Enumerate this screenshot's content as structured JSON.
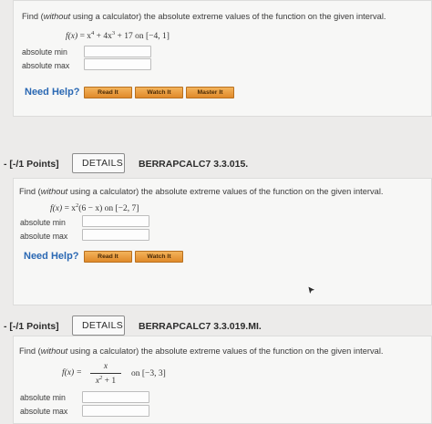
{
  "problem1": {
    "prompt_pre": "Find (",
    "prompt_em": "without",
    "prompt_post": " using a calculator) the absolute extreme values of the function on the given interval.",
    "f_label": "f(x)",
    "f_expr_a": " = x",
    "f_exp1": "4",
    "f_expr_b": " + 4x",
    "f_exp2": "3",
    "f_expr_c": " + 17 on [−4, 1]",
    "min_label": "absolute min",
    "max_label": "absolute max",
    "min_value": "",
    "max_value": "",
    "need_help": "Need Help?",
    "read_it": "Read It",
    "watch_it": "Watch It",
    "master_it": "Master It"
  },
  "problem2": {
    "points": "- [-/1 Points]",
    "details": "DETAILS",
    "code": "BERRAPCALC7 3.3.015.",
    "prompt_pre": "Find (",
    "prompt_em": "without",
    "prompt_post": " using a calculator) the absolute extreme values of the function on the given interval.",
    "f_label": "f(x)",
    "f_expr_a": " = x",
    "f_exp1": "2",
    "f_expr_b": "(6 − x) on [−2, 7]",
    "min_label": "absolute min",
    "max_label": "absolute max",
    "min_value": "",
    "max_value": "",
    "need_help": "Need Help?",
    "read_it": "Read It",
    "watch_it": "Watch It"
  },
  "problem3": {
    "points": "- [-/1 Points]",
    "details": "DETAILS",
    "code": "BERRAPCALC7 3.3.019.MI.",
    "prompt_pre": "Find (",
    "prompt_em": "without",
    "prompt_post": " using a calculator) the absolute extreme values of the function on the given interval.",
    "f_label": "f(x) =",
    "frac_num": "x",
    "frac_den_a": "x",
    "frac_den_exp": "2",
    "frac_den_b": " + 1",
    "interval": "on [−3, 3]",
    "min_label": "absolute min",
    "max_label": "absolute max",
    "min_value": "",
    "max_value": ""
  },
  "colors": {
    "need_help": "#2a68b3",
    "help_button": "#e8982f",
    "card_bg": "#f7f7f6",
    "page_bg": "#ecebea"
  }
}
